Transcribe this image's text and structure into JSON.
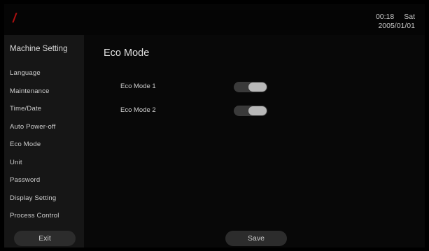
{
  "header": {
    "logo_text": "/",
    "time": "00:18",
    "weekday": "Sat",
    "date": "2005/01/01"
  },
  "sidebar": {
    "title": "Machine Setting",
    "items": [
      {
        "label": "Language"
      },
      {
        "label": "Maintenance"
      },
      {
        "label": "Time/Date"
      },
      {
        "label": "Auto Power-off"
      },
      {
        "label": "Eco Mode"
      },
      {
        "label": "Unit"
      },
      {
        "label": "Password"
      },
      {
        "label": "Display Setting"
      },
      {
        "label": "Process Control"
      }
    ],
    "exit_label": "Exit"
  },
  "main": {
    "title": "Eco Mode",
    "settings": [
      {
        "label": "Eco Mode 1",
        "state": "on"
      },
      {
        "label": "Eco Mode 2",
        "state": "on"
      }
    ],
    "save_label": "Save"
  }
}
